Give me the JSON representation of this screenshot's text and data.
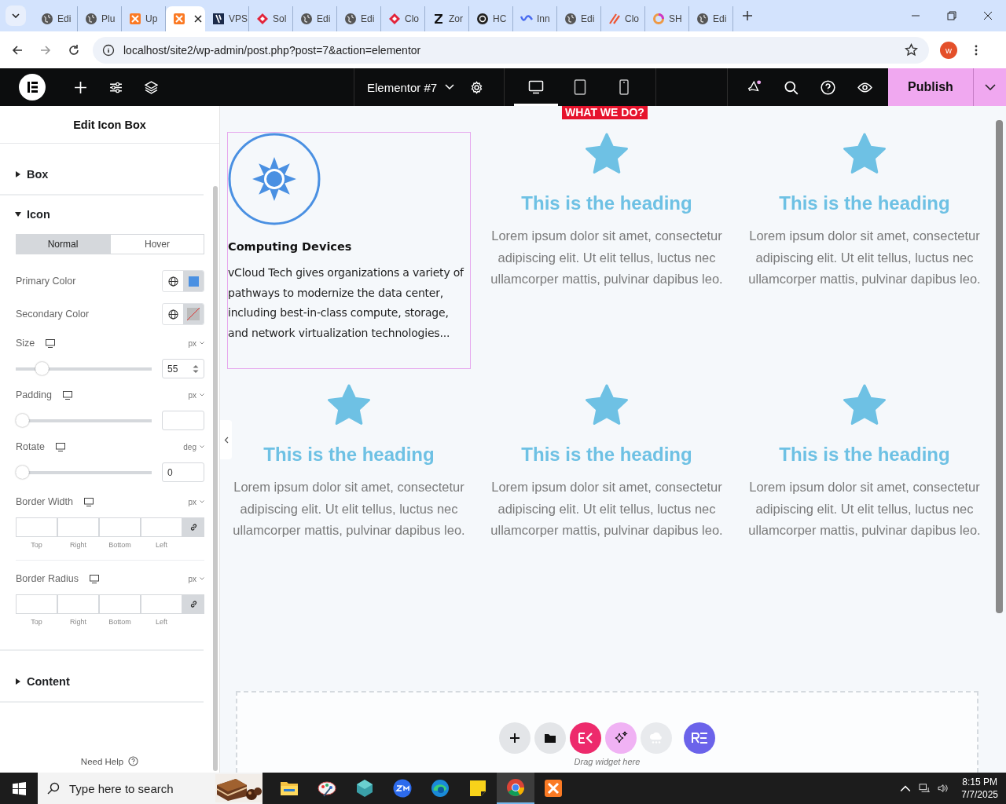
{
  "browser": {
    "tabs": [
      {
        "kind": "globe",
        "label": "Edi",
        "selected": false
      },
      {
        "kind": "globe",
        "label": "Plu",
        "selected": false
      },
      {
        "kind": "xampp",
        "label": "Up",
        "selected": false
      },
      {
        "kind": "xampp",
        "selected": true
      },
      {
        "kind": "vps",
        "label": "VPS",
        "selected": false
      },
      {
        "kind": "diamond",
        "label": "Sol",
        "selected": false
      },
      {
        "kind": "globe",
        "label": "Edi",
        "selected": false
      },
      {
        "kind": "globe",
        "label": "Edi",
        "selected": false
      },
      {
        "kind": "diamond",
        "label": "Clo",
        "selected": false
      },
      {
        "kind": "zeta",
        "label": "Zor",
        "selected": false
      },
      {
        "kind": "knot",
        "label": "HC",
        "selected": false
      },
      {
        "kind": "wave",
        "label": "Inn",
        "selected": false
      },
      {
        "kind": "globe",
        "label": "Edi",
        "selected": false
      },
      {
        "kind": "slash",
        "label": "Clo",
        "selected": false
      },
      {
        "kind": "ring",
        "label": "SH",
        "selected": false
      },
      {
        "kind": "globe",
        "label": "Edi",
        "selected": false
      }
    ],
    "url": "localhost/site2/wp-admin/post.php?post=7&action=elementor",
    "profile": "w"
  },
  "editor_bar": {
    "document": "Elementor #7",
    "devices": [
      {
        "selected": true
      },
      {
        "selected": false
      },
      {
        "selected": false
      }
    ],
    "publish": "Publish"
  },
  "panel": {
    "title": "Edit Icon Box",
    "sections": [
      {
        "title": "Box",
        "expanded": false
      },
      {
        "title": "Icon",
        "expanded": true,
        "controls": [
          {
            "kind": "state_tabs",
            "options": [
              {
                "label": "Normal",
                "selected": true
              },
              {
                "label": "Hover",
                "selected": false
              }
            ]
          },
          {
            "kind": "color",
            "label": "Primary Color",
            "color": "#4a90e2"
          },
          {
            "kind": "color",
            "label": "Secondary Color"
          },
          {
            "kind": "slider",
            "label": "Size",
            "unit": "px",
            "level": 0.16,
            "value": "55",
            "stepper": true
          },
          {
            "kind": "slider",
            "label": "Padding",
            "unit": "px",
            "level": 0,
            "stepper": false
          },
          {
            "kind": "slider",
            "label": "Rotate",
            "unit": "deg",
            "level": 0,
            "value": "0",
            "stepper": false
          },
          {
            "kind": "dimensions",
            "label": "Border Width",
            "unit": "px",
            "sides": [
              "Top",
              "Right",
              "Bottom",
              "Left"
            ]
          },
          {
            "kind": "dimensions",
            "label": "Border Radius",
            "unit": "px",
            "sides": [
              "Top",
              "Right",
              "Bottom",
              "Left"
            ]
          }
        ]
      },
      {
        "title": "Content",
        "expanded": false
      }
    ],
    "help": "Need Help"
  },
  "canvas": {
    "badge": "WHAT WE DO?",
    "boxes": [
      {
        "kind": "feature",
        "selected": true,
        "title": "Computing Devices",
        "text": "vCloud Tech gives organizations a variety of pathways to modernize the data center, including best-in-class compute, storage, and network virtualization technologies..."
      },
      {
        "kind": "star",
        "selected": false,
        "title": "This is the heading",
        "text": "Lorem ipsum dolor sit amet, consectetur adipiscing elit. Ut elit tellus, luctus nec ullamcorper mattis, pulvinar dapibus leo."
      },
      {
        "kind": "star",
        "selected": false,
        "title": "This is the heading",
        "text": "Lorem ipsum dolor sit amet, consectetur adipiscing elit. Ut elit tellus, luctus nec ullamcorper mattis, pulvinar dapibus leo."
      },
      {
        "kind": "star",
        "selected": false,
        "title": "This is the heading",
        "text": "Lorem ipsum dolor sit amet, consectetur adipiscing elit. Ut elit tellus, luctus nec ullamcorper mattis, pulvinar dapibus leo."
      },
      {
        "kind": "star",
        "selected": false,
        "title": "This is the heading",
        "text": "Lorem ipsum dolor sit amet, consectetur adipiscing elit. Ut elit tellus, luctus nec ullamcorper mattis, pulvinar dapibus leo."
      },
      {
        "kind": "star",
        "selected": false,
        "title": "This is the heading",
        "text": "Lorem ipsum dolor sit amet, consectetur adipiscing elit. Ut elit tellus, luctus nec ullamcorper mattis, pulvinar dapibus leo."
      }
    ],
    "dropzone": {
      "buttons": [
        {
          "kind": "add"
        },
        {
          "kind": "folder"
        },
        {
          "kind": "ek"
        },
        {
          "kind": "ai"
        },
        {
          "kind": "cloud"
        },
        {
          "kind": "re"
        }
      ],
      "hint": "Drag widget here"
    }
  },
  "taskbar": {
    "search_placeholder": "Type here to search",
    "apps": [
      {
        "kind": "explorer",
        "selected": false
      },
      {
        "kind": "paint",
        "selected": false
      },
      {
        "kind": "gem",
        "selected": false
      },
      {
        "kind": "zoom",
        "selected": false
      },
      {
        "kind": "edge",
        "selected": false
      },
      {
        "kind": "notes",
        "selected": false
      },
      {
        "kind": "chrome",
        "selected": true
      },
      {
        "kind": "xampp",
        "selected": false
      }
    ],
    "time": "8:15 PM",
    "date": "7/7/2025"
  }
}
